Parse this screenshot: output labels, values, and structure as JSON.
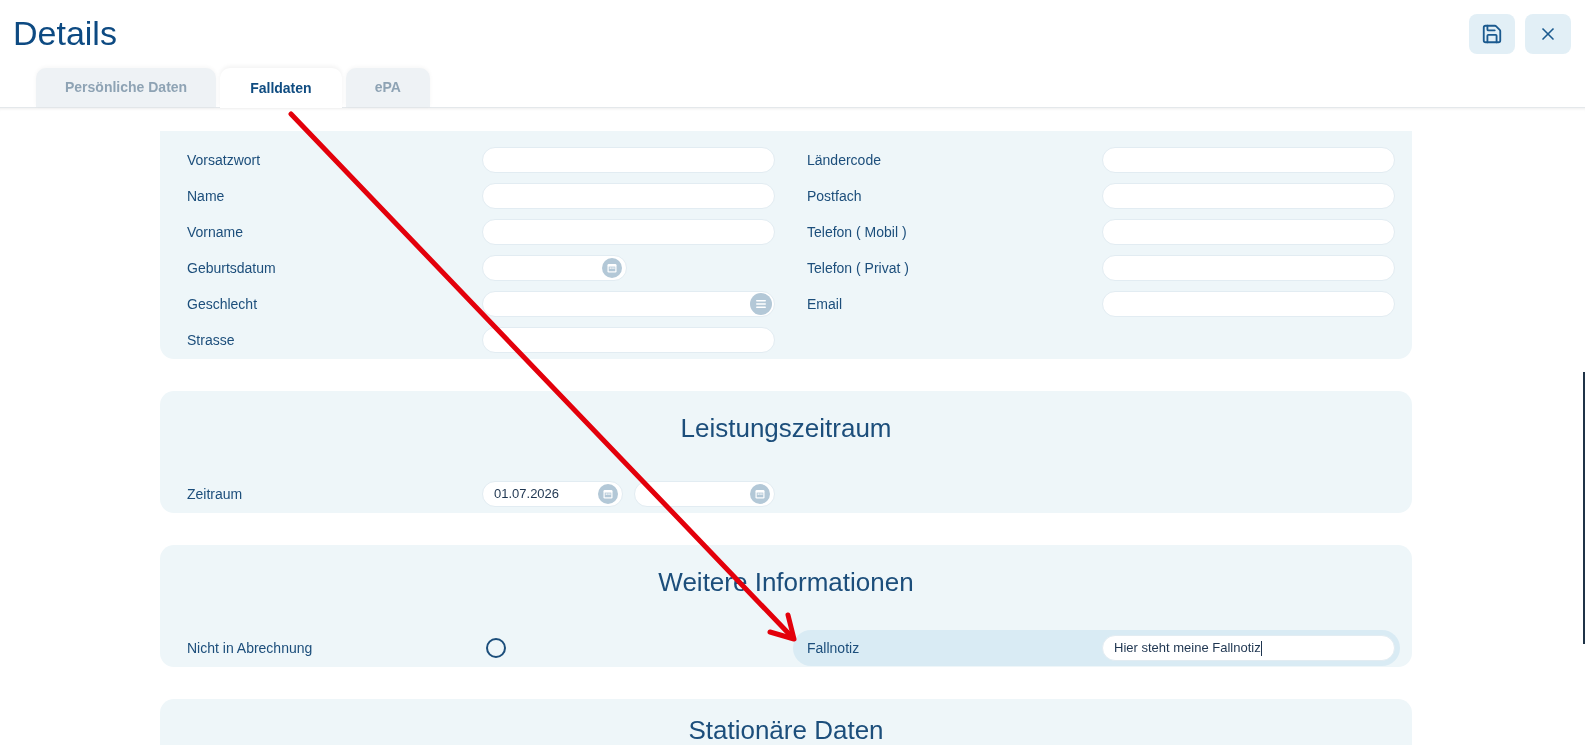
{
  "header": {
    "title": "Details"
  },
  "tabs": [
    {
      "label": "Persönliche Daten",
      "selected": false
    },
    {
      "label": "Falldaten",
      "selected": true
    },
    {
      "label": "ePA",
      "selected": false
    }
  ],
  "sections": [
    {
      "columns": [
        [
          {
            "label": "Vorsatzwort",
            "kind": "text"
          },
          {
            "label": "Name",
            "kind": "text"
          },
          {
            "label": "Vorname",
            "kind": "text"
          },
          {
            "label": "Geburtsdatum",
            "kind": "date"
          },
          {
            "label": "Geschlecht",
            "kind": "select"
          },
          {
            "label": "Strasse",
            "kind": "text"
          }
        ],
        [
          {
            "label": "Ländercode",
            "kind": "text"
          },
          {
            "label": "Postfach",
            "kind": "text"
          },
          {
            "label": "Telefon ( Mobil )",
            "kind": "text"
          },
          {
            "label": "Telefon ( Privat )",
            "kind": "text"
          },
          {
            "label": "Email",
            "kind": "text"
          }
        ]
      ]
    },
    {
      "title": "Leistungszeitraum",
      "columns": [
        [
          {
            "label": "Zeitraum",
            "kind": "date_range",
            "from": "01.07.2026"
          }
        ]
      ]
    },
    {
      "title": "Weitere Informationen",
      "columns": [
        [
          {
            "label": "Nicht in Abrechnung",
            "kind": "radio",
            "checked": false
          }
        ],
        [
          {
            "label": "Fallnotiz",
            "kind": "text",
            "value": "Hier steht meine Fallnotiz",
            "focused": true
          }
        ]
      ]
    },
    {
      "title": "Stationäre Daten"
    }
  ]
}
